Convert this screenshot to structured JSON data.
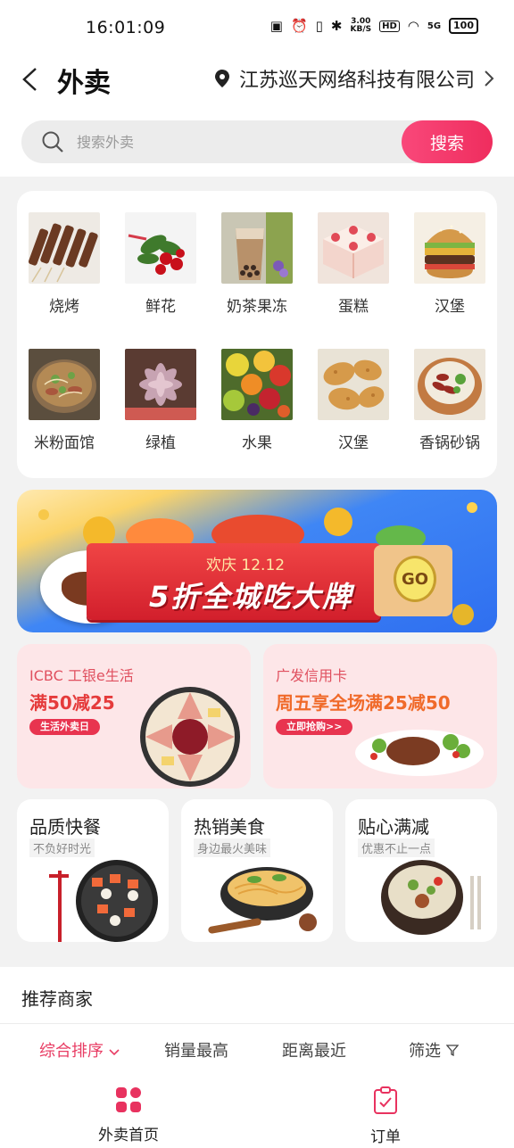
{
  "status": {
    "time": "16:01:09",
    "speed_top": "3.00",
    "speed_bottom": "KB/S",
    "battery": "100",
    "hd": "HD",
    "signal": "5G"
  },
  "header": {
    "title": "外卖",
    "location": "江苏巡天网络科技有限公司"
  },
  "search": {
    "placeholder": "搜索外卖",
    "button": "搜索"
  },
  "categories": [
    {
      "label": "烧烤",
      "icon": "bbq-skewers-photo"
    },
    {
      "label": "鲜花",
      "icon": "roses-photo"
    },
    {
      "label": "奶茶果冻",
      "icon": "milk-tea-photo"
    },
    {
      "label": "蛋糕",
      "icon": "cake-photo"
    },
    {
      "label": "汉堡",
      "icon": "burger-photo"
    },
    {
      "label": "米粉面馆",
      "icon": "noodle-bowl-photo"
    },
    {
      "label": "绿植",
      "icon": "succulent-photo"
    },
    {
      "label": "水果",
      "icon": "fruit-photo"
    },
    {
      "label": "汉堡",
      "icon": "fried-chicken-photo"
    },
    {
      "label": "香锅砂锅",
      "icon": "clay-pot-photo"
    }
  ],
  "banner": {
    "subtitle": "欢庆 12.12",
    "headline": "5折全城吃大牌",
    "go": "GO"
  },
  "promos": [
    {
      "brand": "ICBC",
      "title": "工银e生活",
      "main": "满50减25",
      "tag": "生活外卖日"
    },
    {
      "title": "广发信用卡",
      "main": "周五享全场满25减50",
      "tag": "立即抢购>>"
    }
  ],
  "features": [
    {
      "title": "品质快餐",
      "sub": "不负好时光"
    },
    {
      "title": "热销美食",
      "sub": "身边最火美味"
    },
    {
      "title": "贴心满减",
      "sub": "优惠不止一点"
    }
  ],
  "section": {
    "title": "推荐商家"
  },
  "sort": {
    "comprehensive": "综合排序",
    "sales": "销量最高",
    "distance": "距离最近",
    "filter": "筛选"
  },
  "tabs": [
    {
      "label": "外卖首页"
    },
    {
      "label": "订单"
    }
  ],
  "colors": {
    "accent": "#ef2d5e",
    "active_sort": "#e83d64",
    "page_bg": "#f2f2f2"
  }
}
